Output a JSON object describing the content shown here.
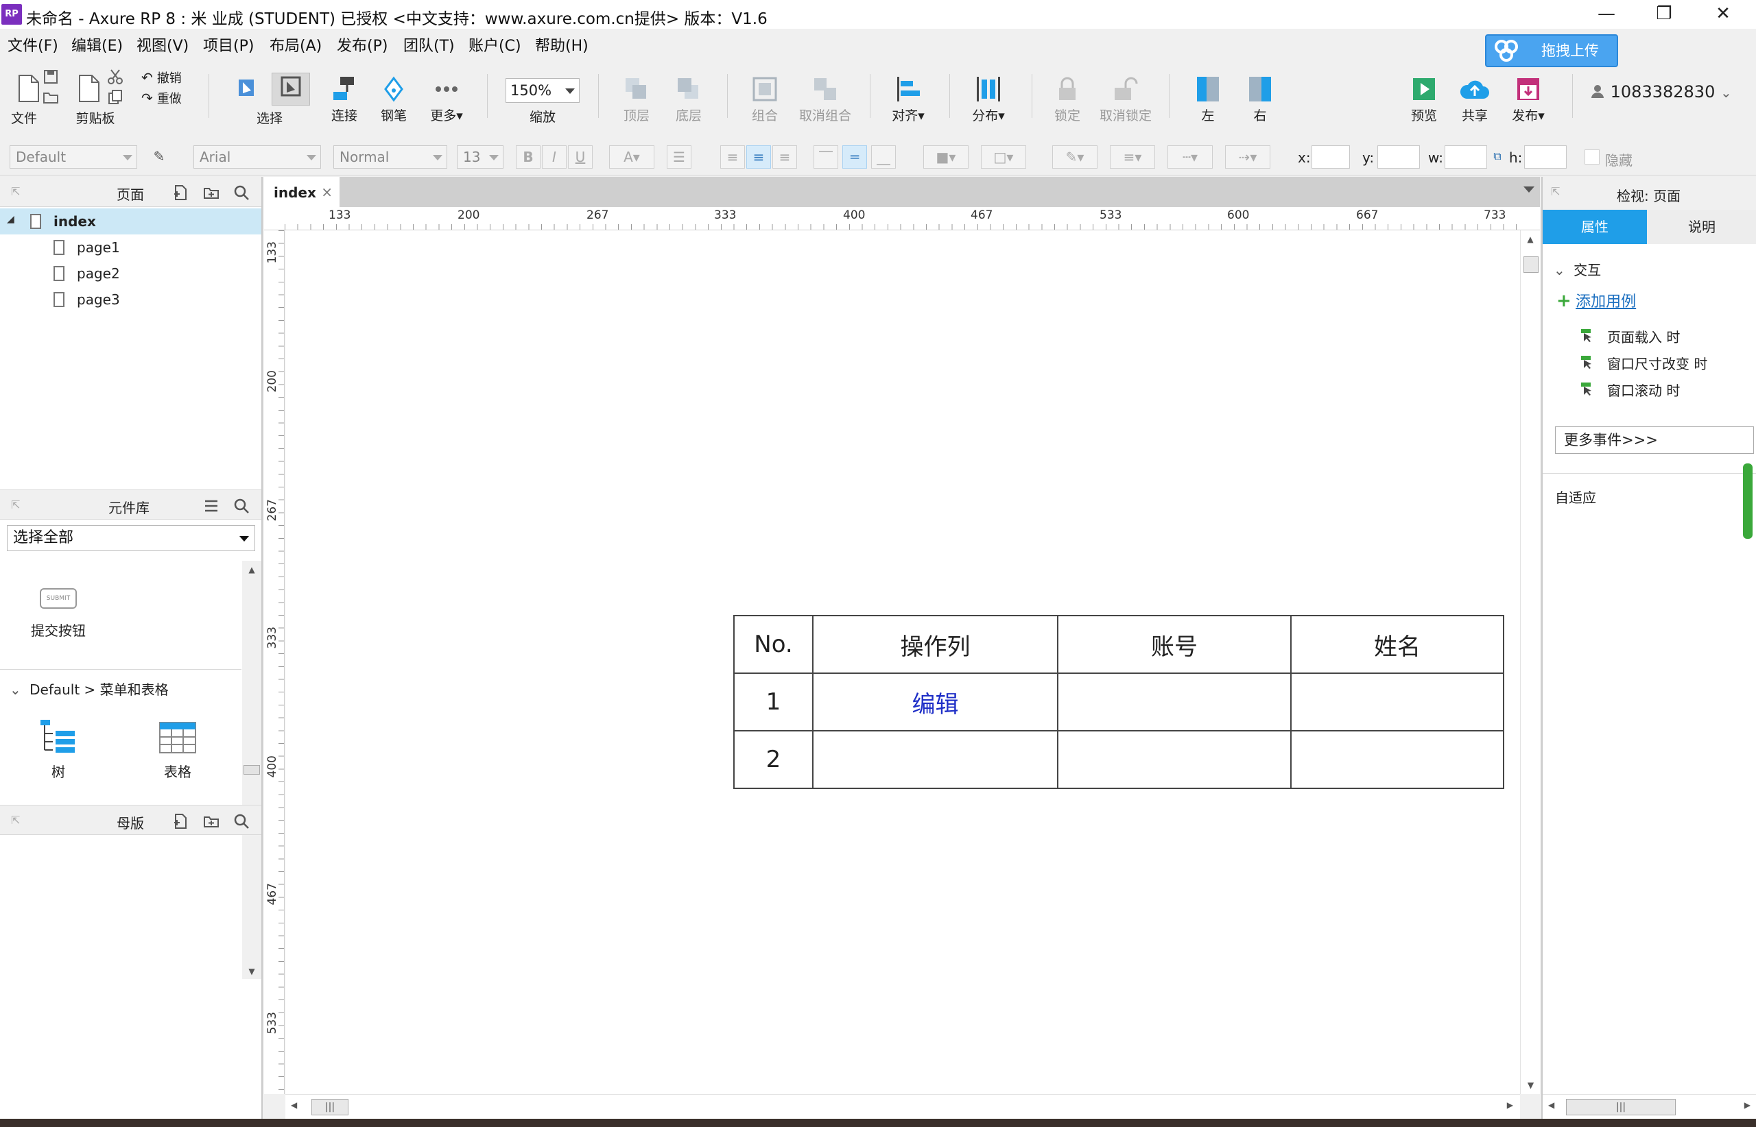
{
  "window": {
    "logo": "RP",
    "title": "未命名 - Axure RP 8 : 米 业成 (STUDENT) 已授权     <中文支持：www.axure.com.cn提供> 版本：V1.6",
    "minimize": "—",
    "restore": "❐",
    "close": "✕"
  },
  "menu": {
    "items": [
      "文件(F)",
      "编辑(E)",
      "视图(V)",
      "项目(P)",
      "布局(A)",
      "发布(P)",
      "团队(T)",
      "账户(C)",
      "帮助(H)"
    ],
    "upload_label": "拖拽上传"
  },
  "toolbar": {
    "file": "文件",
    "clipboard": "剪贴板",
    "undo": "撤销",
    "redo": "重做",
    "select": "选择",
    "connect": "连接",
    "pen": "钢笔",
    "more": "更多▾",
    "zoom_value": "150%",
    "zoom_label": "缩放",
    "top_layer": "顶层",
    "bottom_layer": "底层",
    "group": "组合",
    "ungroup": "取消组合",
    "align": "对齐▾",
    "distribute": "分布▾",
    "lock": "锁定",
    "unlock": "取消锁定",
    "left": "左",
    "right": "右",
    "preview": "预览",
    "share": "共享",
    "publish": "发布▾",
    "user": "1083382830"
  },
  "format": {
    "style": "Default",
    "font": "Arial",
    "weight": "Normal",
    "size": "13",
    "bold": "B",
    "italic": "I",
    "underline": "U",
    "x_label": "x:",
    "y_label": "y:",
    "w_label": "w:",
    "h_label": "h:",
    "hidden_label": "隐藏"
  },
  "pages_panel": {
    "title": "页面",
    "pages": [
      "index",
      "page1",
      "page2",
      "page3"
    ]
  },
  "library_panel": {
    "title": "元件库",
    "selector": "选择全部",
    "submit_icon_text": "SUBMIT",
    "submit_label": "提交按钮",
    "section": "Default > 菜单和表格",
    "tree_label": "树",
    "table_label": "表格"
  },
  "masters_panel": {
    "title": "母版"
  },
  "canvas": {
    "tab": "index",
    "tab_close": "×",
    "hruler": [
      "133",
      "200",
      "267",
      "333",
      "400",
      "467",
      "533",
      "600",
      "667",
      "733"
    ],
    "vruler": [
      "133",
      "200",
      "267",
      "333",
      "400",
      "467",
      "533"
    ],
    "table": {
      "headers": [
        "No.",
        "操作列",
        "账号",
        "姓名"
      ],
      "rows": [
        [
          "1",
          "编辑",
          "",
          ""
        ],
        [
          "2",
          "",
          "",
          ""
        ]
      ]
    }
  },
  "inspector": {
    "title": "检视: 页面",
    "tab_properties": "属性",
    "tab_notes": "说明",
    "interaction": "交互",
    "add_case": "添加用例",
    "events": [
      "页面载入 时",
      "窗口尺寸改变 时",
      "窗口滚动 时"
    ],
    "more_events": "更多事件>>>",
    "adaptive": "自适应"
  },
  "colors": {
    "accent": "#1f9ee8",
    "link": "#1f2fc7",
    "selection": "#cce8f6"
  }
}
